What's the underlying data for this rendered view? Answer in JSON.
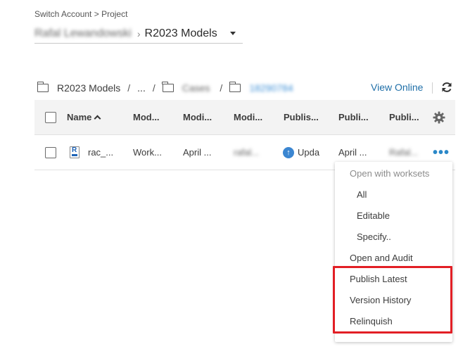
{
  "breadcrumb": {
    "switch_account": "Switch Account",
    "separator": ">",
    "project_link": "Project"
  },
  "project_selector": {
    "account_name": "Rafal Lewandowski",
    "separator": "›",
    "project_name": "R2023 Models"
  },
  "folder_path": {
    "root": "R2023 Models",
    "sep": "/",
    "ellipsis": "...",
    "folder_2": "Cases",
    "folder_3": "18290784"
  },
  "toolbar": {
    "view_online": "View Online"
  },
  "table": {
    "columns": [
      "Name",
      "Mod...",
      "Modi...",
      "Modi...",
      "Publis...",
      "Publi...",
      "Publi..."
    ],
    "row": {
      "name": "rac_...",
      "col2": "Work...",
      "col3": "April ...",
      "col4": "rafal...",
      "col5": "Upda",
      "col6": "April ...",
      "col7": "Rafal..."
    }
  },
  "context_menu": {
    "items": [
      {
        "label": "Open with worksets",
        "disabled": true
      },
      {
        "label": "All"
      },
      {
        "label": "Editable"
      },
      {
        "label": "Specify.."
      },
      {
        "label": "Open and Audit"
      },
      {
        "label": "Publish Latest"
      },
      {
        "label": "Version History"
      },
      {
        "label": "Relinquish"
      }
    ]
  },
  "colors": {
    "accent_blue": "#1f6fa8",
    "highlight_red": "#e21f25",
    "header_bg": "#f3f3f3"
  },
  "icons": [
    "folder-icon",
    "refresh-icon",
    "gear-icon",
    "rvt-file-icon",
    "update-arrow-icon",
    "more-options-icon",
    "sort-ascending-icon",
    "caret-down-icon"
  ]
}
